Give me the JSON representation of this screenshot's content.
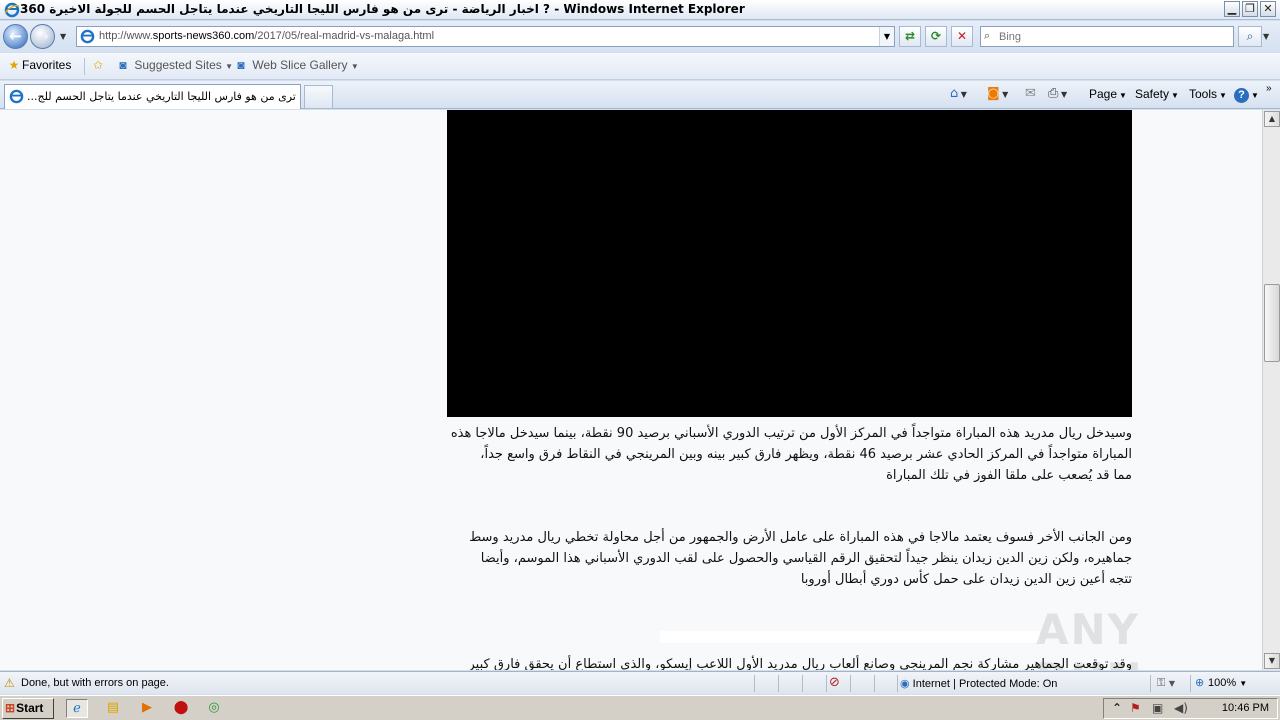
{
  "window": {
    "title": "360 اخبار الرياضة - ترى من هو فارس الليجا التاريخي عندما يتاجل الحسم للجولة الاخيرة ? - Windows Internet Explorer",
    "controls": {
      "minimize": "▁",
      "restore": "❐",
      "close": "✕"
    }
  },
  "address_bar": {
    "url_prefix": "http://www.",
    "url_domain": "sports-news360.com",
    "url_path": "/2017/05/real-madrid-vs-malaga.html",
    "dropdown": "▼"
  },
  "search": {
    "placeholder": "Bing",
    "go": "⌕"
  },
  "favorites_bar": {
    "favorites": "Favorites",
    "suggested_sites": "Suggested Sites",
    "web_slice_gallery": "Web Slice Gallery"
  },
  "tab": {
    "label": "...ترى من هو فارس الليجا التاريخي عندما يتاجل الحسم للج"
  },
  "command_bar": {
    "page": "Page",
    "safety": "Safety",
    "tools": "Tools",
    "help": "?"
  },
  "article": {
    "p1": "وسيدخل ريال مدريد هذه المباراة متواجداً في المركز الأول من ترتيب الدوري الأسباني برصيد 90 نقطة، بينما سيدخل مالاجا هذه",
    "p1b": "المباراة متواجداً في المركز الحادي عشر برصيد 46 نقطة، ويظهر فارق كبير بينه وبين المرينجي في النقاط فرق واسع جداً،",
    "p1c": "مما قد يُصعب على ملقا الفوز في تلك المباراة",
    "p2": "ومن الجانب الأخر فسوف يعتمد مالاجا في هذه المباراة على عامل الأرض والجمهور من أجل محاولة تخطي ريال مدريد وسط",
    "p2b": "جماهيره، ولكن زين الدين زيدان ينظر جيداً لتحقيق الرقم القياسي والحصول على لقب الدوري الأسباني هذا الموسم، وأيضا",
    "p2c": "تتجه أعين زين الدين زيدان على حمل كأس دوري أبطال أوروبا",
    "p3": "وقد توقعت الجماهير مشاركة نجم المرينجي وصانع ألعاب ريال مدريد الأول اللاعب إيسكو، والذي استطاع أن يحقق فارق كبير"
  },
  "watermark": "ANY RUN",
  "status_bar": {
    "message": "Done, but with errors on page.",
    "zone": "Internet | Protected Mode: On",
    "zoom": "100%"
  },
  "taskbar": {
    "start": "Start",
    "clock": "10:46 PM"
  }
}
